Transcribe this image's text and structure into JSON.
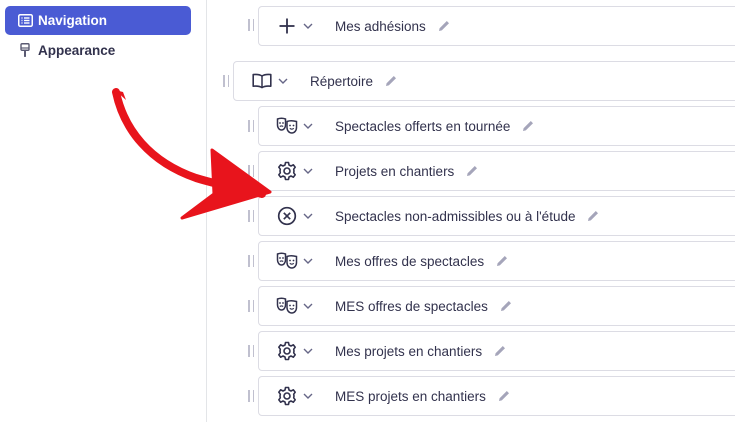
{
  "sidebar": {
    "items": [
      {
        "label": "Navigation",
        "icon": "list-icon",
        "active": true
      },
      {
        "label": "Appearance",
        "icon": "paint-brush-icon",
        "active": false
      }
    ]
  },
  "nav_items": [
    {
      "label": "Mes adhésions",
      "icon": "plus-icon"
    },
    {
      "label": "Répertoire",
      "icon": "book-icon"
    },
    {
      "label": "Spectacles offerts en tournée",
      "icon": "theater-masks-icon"
    },
    {
      "label": "Projets en chantiers",
      "icon": "gear-icon"
    },
    {
      "label": "Spectacles non-admissibles ou à l'étude",
      "icon": "circle-x-icon"
    },
    {
      "label": "Mes offres de spectacles",
      "icon": "theater-masks-icon"
    },
    {
      "label": "MES offres de spectacles",
      "icon": "theater-masks-icon"
    },
    {
      "label": "Mes projets en chantiers",
      "icon": "gear-icon"
    },
    {
      "label": "MES projets en chantiers",
      "icon": "gear-icon"
    }
  ],
  "colors": {
    "accent": "#4a5bd4",
    "arrow": "#e8141c",
    "text": "#32324d",
    "border": "#dcdce4"
  }
}
